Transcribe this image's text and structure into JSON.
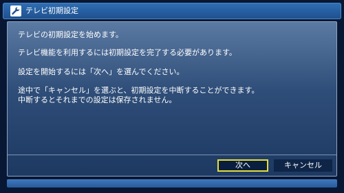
{
  "window": {
    "title": "テレビ初期設定",
    "icon": "wrench-icon"
  },
  "message": {
    "line1": "テレビの初期設定を始めます。",
    "line2": "テレビ機能を利用するには初期設定を完了する必要があります。",
    "line3": "設定を開始するには「次へ」を選んでください。",
    "line4": "途中で「キャンセル」を選ぶと、初期設定を中断することができます。",
    "line5": "中断するとそれまでの設定は保存されません。"
  },
  "buttons": {
    "next_label": "次へ",
    "cancel_label": "キャンセル",
    "focused": "next"
  },
  "colors": {
    "focus_border": "#e6df3a",
    "title_bar": "#2f6fb4",
    "footer_bar": "#3f79bf"
  }
}
